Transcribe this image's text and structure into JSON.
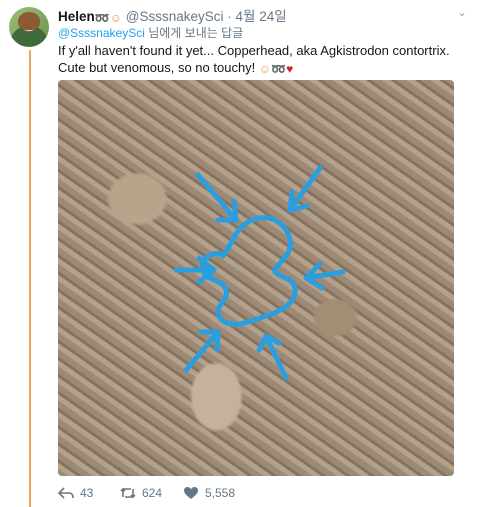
{
  "tweet": {
    "author_name": "Helen",
    "author_emojis": [
      "snake",
      "woman-scientist"
    ],
    "handle": "@SsssnakeySci",
    "separator": "·",
    "date": "4월 24일",
    "reply_to_mention": "@SsssnakeySci",
    "reply_to_suffix": " 님에게 보내는 답글",
    "text": "If y'all haven't found it yet... Copperhead, aka Agkistrodon contortrix. Cute but venomous, so no touchy!",
    "text_emojis": [
      "blushing-face",
      "snake",
      "red-heart"
    ],
    "actions": {
      "reply_count": "43",
      "retweet_count": "624",
      "like_count": "5,558"
    }
  },
  "media": {
    "description_icons": [
      "camouflaged-snake-outline",
      "arrow-pointer"
    ],
    "outline_color": "#2a9fe0",
    "background_color": "#9d8b77"
  },
  "colors": {
    "thread_line": "#f0a35a",
    "link": "#1da1f2",
    "muted": "#657786"
  }
}
